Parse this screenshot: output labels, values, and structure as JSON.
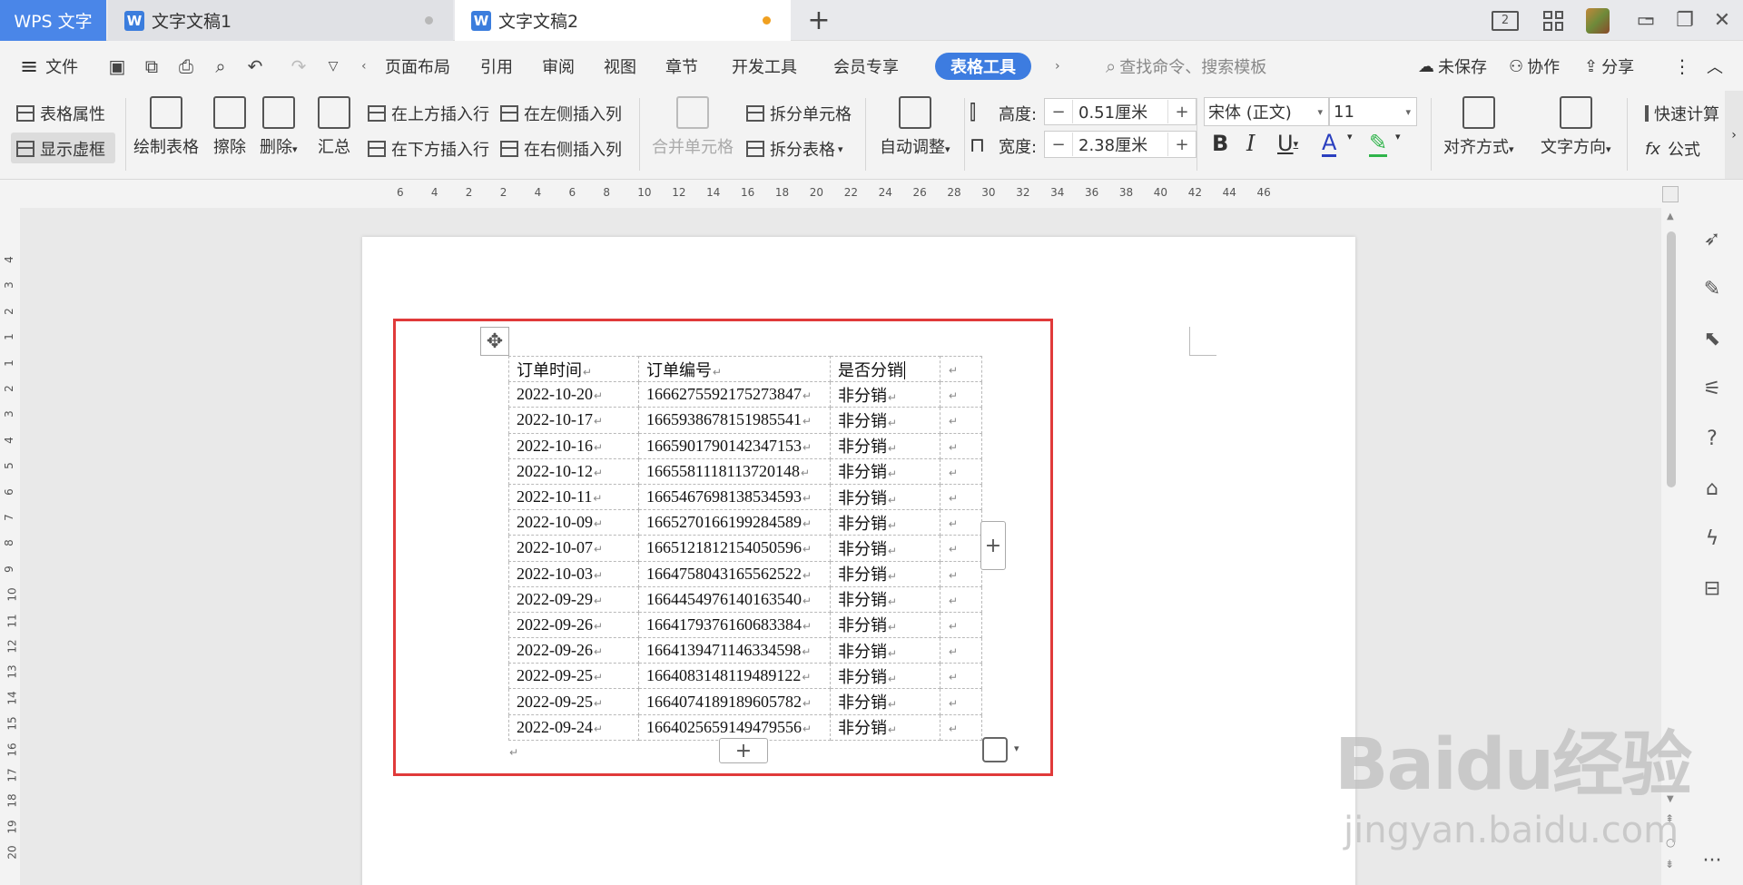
{
  "titlebar": {
    "app_tab": "WPS 文字",
    "tabs": [
      {
        "label": "文字文稿1",
        "dot_color": "#b8b8b8"
      },
      {
        "label": "文字文稿2",
        "dot_color": "#f0a020"
      }
    ],
    "new_tab": "+",
    "layout_badge": "2",
    "colors": {
      "accent": "#4a86e8",
      "active_tab": "#ffffff"
    }
  },
  "menubar": {
    "file": "文件",
    "items": [
      "页面布局",
      "引用",
      "审阅",
      "视图",
      "章节",
      "开发工具",
      "会员专享"
    ],
    "active_tool": "表格工具",
    "search_placeholder": "查找命令、搜索模板",
    "unsaved": "未保存",
    "collab": "协作",
    "share": "分享"
  },
  "ribbon": {
    "table_props": "表格属性",
    "show_gridlines": "显示虚框",
    "draw_table": "绘制表格",
    "erase": "擦除",
    "delete": "删除",
    "summary": "汇总",
    "insert_above": "在上方插入行",
    "insert_below": "在下方插入行",
    "insert_left": "在左侧插入列",
    "insert_right": "在右侧插入列",
    "merge_cells": "合并单元格",
    "split_cells": "拆分单元格",
    "split_table": "拆分表格",
    "auto_fit": "自动调整",
    "height_label": "高度:",
    "height_value": "0.51厘米",
    "width_label": "宽度:",
    "width_value": "2.38厘米",
    "font_name": "宋体 (正文)",
    "font_size": "11",
    "align": "对齐方式",
    "text_dir": "文字方向",
    "quick_calc": "快速计算",
    "formula": "公式"
  },
  "table": {
    "header": [
      "订单时间",
      "订单编号",
      "是否分销"
    ],
    "rows": [
      [
        "2022-10-20",
        "1666275592175273847",
        "非分销"
      ],
      [
        "2022-10-17",
        "1665938678151985541",
        "非分销"
      ],
      [
        "2022-10-16",
        "1665901790142347153",
        "非分销"
      ],
      [
        "2022-10-12",
        "1665581118113720148",
        "非分销"
      ],
      [
        "2022-10-11",
        "1665467698138534593",
        "非分销"
      ],
      [
        "2022-10-09",
        "1665270166199284589",
        "非分销"
      ],
      [
        "2022-10-07",
        "1665121812154050596",
        "非分销"
      ],
      [
        "2022-10-03",
        "1664758043165562522",
        "非分销"
      ],
      [
        "2022-09-29",
        "1664454976140163540",
        "非分销"
      ],
      [
        "2022-09-26",
        "1664179376160683384",
        "非分销"
      ],
      [
        "2022-09-26",
        "1664139471146334598",
        "非分销"
      ],
      [
        "2022-09-25",
        "1664083148119489122",
        "非分销"
      ],
      [
        "2022-09-25",
        "1664074189189605782",
        "非分销"
      ],
      [
        "2022-09-24",
        "1664025659149479556",
        "非分销"
      ]
    ]
  },
  "ruler": {
    "h_ticks": [
      "6",
      "4",
      "2",
      "2",
      "4",
      "6",
      "8",
      "10",
      "12",
      "14",
      "16",
      "18",
      "20",
      "22",
      "24",
      "26",
      "28",
      "30",
      "32",
      "34",
      "36",
      "38",
      "40",
      "42",
      "44",
      "46"
    ],
    "v_ticks": [
      "4",
      "3",
      "2",
      "1",
      "1",
      "2",
      "3",
      "4",
      "5",
      "6",
      "7",
      "8",
      "9",
      "10",
      "11",
      "12",
      "13",
      "14",
      "15",
      "16",
      "17",
      "18",
      "19",
      "20"
    ]
  },
  "watermark": {
    "logo": "Baidu经验",
    "url": "jingyan.baidu.com"
  }
}
